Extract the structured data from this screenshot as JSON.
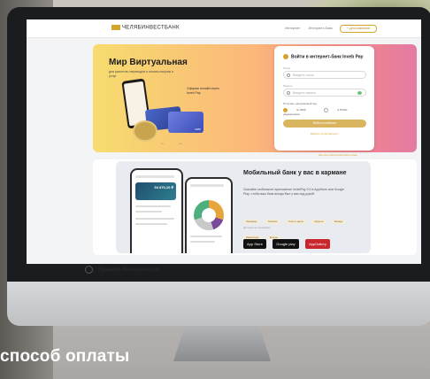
{
  "header": {
    "brand": "ЧЕЛЯБИНВЕСТБАНК",
    "nav_links": [
      "Интернет",
      "Интернет-банк"
    ],
    "nav_button": "+ Для компаний"
  },
  "hero": {
    "title": "Мир Виртуальная",
    "subtitle": "для расчетов, переводов и оплаты покупок и услуг",
    "callout": "Оформи онлайн через Inveb Pay",
    "card_label": "МИР",
    "nav_arrows": "← →"
  },
  "login": {
    "title": "Войти в интернет-банк Inveb Pay",
    "login_label": "Логин",
    "login_placeholder": "Введите логин",
    "password_label": "Пароль",
    "password_placeholder": "Введите пароль",
    "confirm_label": "Получать одноразовый код",
    "radio_options": [
      "по SMS",
      "в PUSH-уведомлении"
    ],
    "submit": "Войти в кабинет",
    "forgot": "Забыли логин/пароль?"
  },
  "hero_footnote": "Как стать клиентом без визита в банк",
  "mobile": {
    "title": "Мобильный банк у вас в кармане",
    "text": "Скачайте мобильное приложение InvebPay 2.0 в AppStore или Google Play, чтобы ваш банк всегда был у вас под рукой!",
    "chips": [
      "Переводы",
      "Платежи",
      "Счета и карты",
      "Кредиты",
      "Вклады",
      "Инвестиции",
      "Бонусы"
    ],
    "note": "Доступно на платформах",
    "stores": [
      "App Store",
      "Google play",
      "AppGallery"
    ],
    "phone_balance": "54 870,10 ₽",
    "phone_header": "Виртуальная в рублях",
    "phone2_header": "Расходы"
  },
  "below": {
    "title": "Правила безопасности"
  },
  "caption": "способ оплаты",
  "colors": {
    "accent": "#d4a52b",
    "hero_start": "#f7dc6f",
    "hero_end": "#e47aa3"
  }
}
